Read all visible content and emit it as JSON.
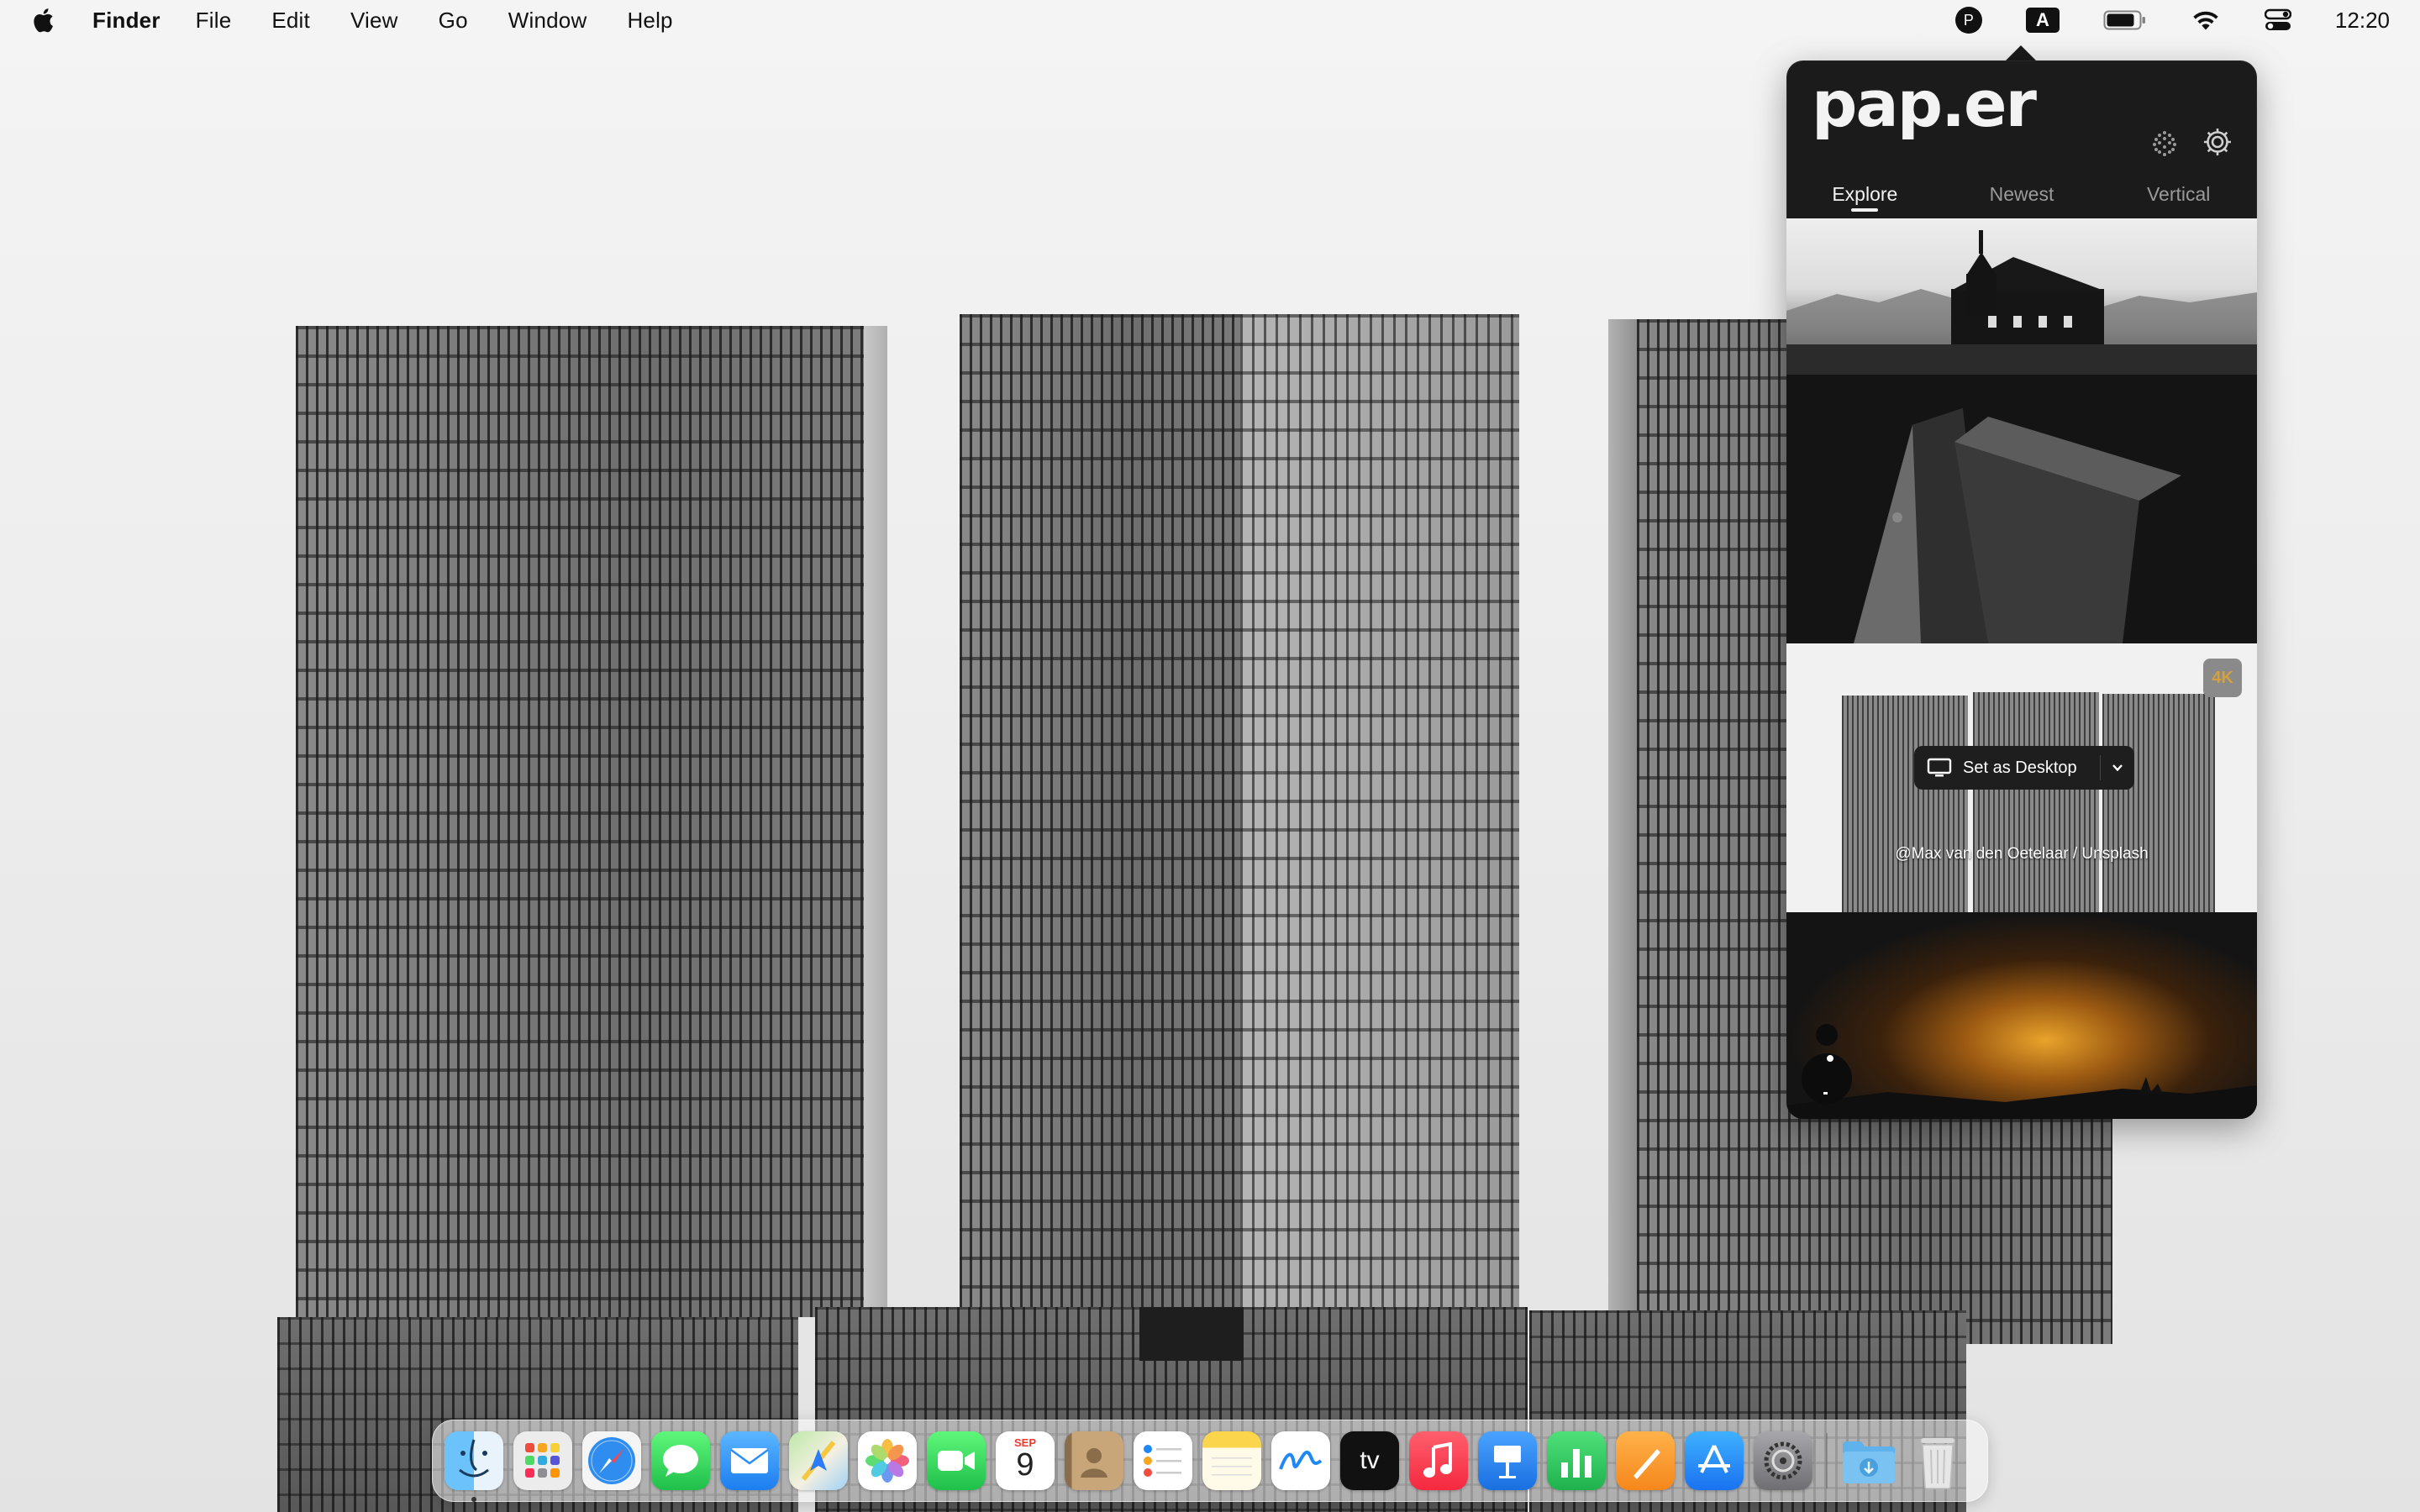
{
  "menubar": {
    "apple_icon": "apple-logo-icon",
    "app_name": "Finder",
    "menus": [
      "File",
      "Edit",
      "View",
      "Go",
      "Window",
      "Help"
    ],
    "status_items": {
      "paper_icon_letter": "P",
      "input_source": "A",
      "battery_icon": "battery-icon",
      "wifi_icon": "wifi-icon",
      "control_center_icon": "control-center-icon"
    },
    "clock": "12:20"
  },
  "popover": {
    "logo": "pap.er",
    "grid_icon": "dots-grid-icon",
    "settings_icon": "gear-icon",
    "tabs": [
      {
        "label": "Explore",
        "active": true
      },
      {
        "label": "Newest",
        "active": false
      },
      {
        "label": "Vertical",
        "active": false
      }
    ],
    "feed": {
      "badge": "4K",
      "set_desktop_label": "Set as Desktop",
      "credit": "@Max van den Oetelaar / Unsplash"
    }
  },
  "dock": {
    "apps": [
      {
        "name": "Finder",
        "icon": "finder-icon",
        "color": "#3aa0f5",
        "running": true
      },
      {
        "name": "Launchpad",
        "icon": "launchpad-icon",
        "color": "#e8e8e8"
      },
      {
        "name": "Safari",
        "icon": "safari-icon",
        "color": "#2f8df0"
      },
      {
        "name": "Messages",
        "icon": "messages-icon",
        "color": "#35c659"
      },
      {
        "name": "Mail",
        "icon": "mail-icon",
        "color": "#2b8ff5"
      },
      {
        "name": "Maps",
        "icon": "maps-icon",
        "color": "#5fb86a"
      },
      {
        "name": "Photos",
        "icon": "photos-icon",
        "color": "#ffffff"
      },
      {
        "name": "FaceTime",
        "icon": "facetime-icon",
        "color": "#33c558"
      },
      {
        "name": "Calendar",
        "icon": "calendar-icon",
        "color": "#ffffff",
        "month": "SEP",
        "day": "9"
      },
      {
        "name": "Contacts",
        "icon": "contacts-icon",
        "color": "#b8956a"
      },
      {
        "name": "Reminders",
        "icon": "reminders-icon",
        "color": "#ffffff"
      },
      {
        "name": "Notes",
        "icon": "notes-icon",
        "color": "#fbd54b"
      },
      {
        "name": "Freeform",
        "icon": "freeform-icon",
        "color": "#ffffff"
      },
      {
        "name": "TV",
        "icon": "tv-icon",
        "color": "#111111",
        "label": "tv"
      },
      {
        "name": "Music",
        "icon": "music-icon",
        "color": "#fa3c50"
      },
      {
        "name": "Keynote",
        "icon": "keynote-icon",
        "color": "#2f84f0"
      },
      {
        "name": "Numbers",
        "icon": "numbers-icon",
        "color": "#34c05a"
      },
      {
        "name": "Pages",
        "icon": "pages-icon",
        "color": "#f79a25"
      },
      {
        "name": "App Store",
        "icon": "app-store-icon",
        "color": "#1f8ef7"
      },
      {
        "name": "System Settings",
        "icon": "system-settings-icon",
        "color": "#8e8e93"
      }
    ],
    "downloads_icon": "downloads-folder-icon",
    "trash_icon": "trash-icon"
  }
}
